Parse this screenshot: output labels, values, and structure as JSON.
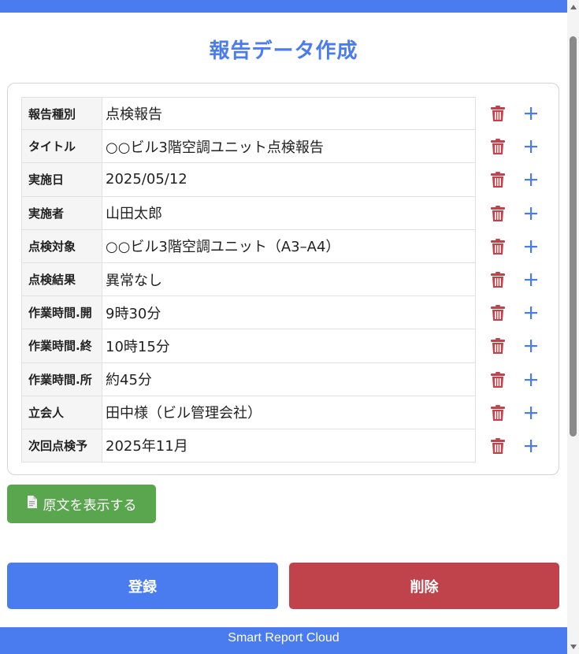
{
  "page": {
    "title": "報告データ作成"
  },
  "report_rows": [
    {
      "key": "報告種別",
      "value": "点検報告"
    },
    {
      "key": "タイトル",
      "value": "○○ビル3階空調ユニット点検報告"
    },
    {
      "key": "実施日",
      "value": "2025/05/12"
    },
    {
      "key": "実施者",
      "value": "山田太郎"
    },
    {
      "key": "点検対象",
      "value": "○○ビル3階空調ユニット（A3–A4）"
    },
    {
      "key": "点検結果",
      "value": "異常なし"
    },
    {
      "key": "作業時間.開",
      "value": "9時30分"
    },
    {
      "key": "作業時間.終",
      "value": "10時15分"
    },
    {
      "key": "作業時間.所",
      "value": "約45分"
    },
    {
      "key": "立会人",
      "value": "田中様（ビル管理会社）"
    },
    {
      "key": "次回点検予",
      "value": "2025年11月"
    }
  ],
  "buttons": {
    "show_source": "原文を表示する",
    "register": "登録",
    "delete": "削除"
  },
  "footer": {
    "text": "Smart Report Cloud"
  },
  "icons": {
    "trash": "trash-icon",
    "plus": "plus-icon",
    "document": "document-icon"
  },
  "colors": {
    "primary": "#4a7cf0",
    "danger": "#c0424a",
    "success": "#5aa64e",
    "trash_icon": "#c0424a",
    "plus_icon": "#4a7cf0"
  }
}
